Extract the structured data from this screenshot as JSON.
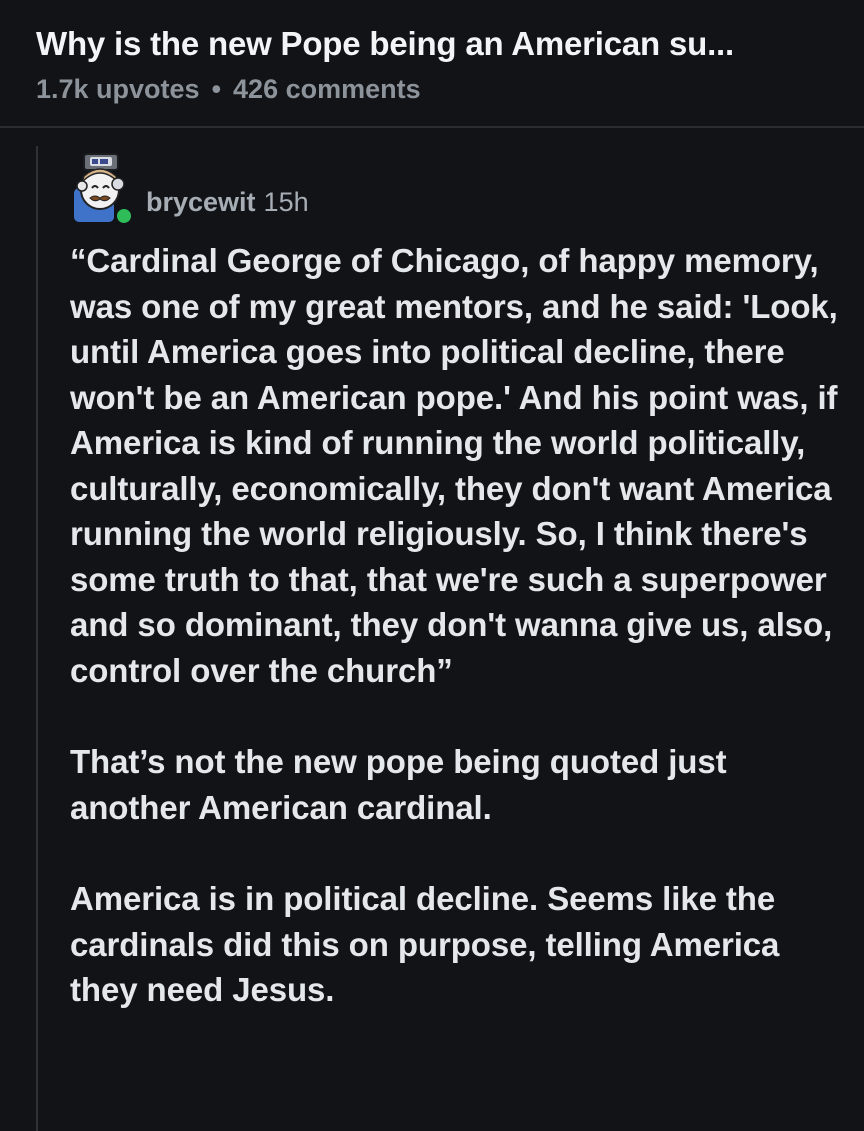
{
  "post": {
    "title": "Why is the new Pope being an American su...",
    "upvotes": "1.7k upvotes",
    "separator": "•",
    "comments": "426 comments"
  },
  "comment": {
    "username": "brycewit",
    "time": "15h",
    "avatar_icon": "snoo-avatar-icon",
    "online_color": "#2ebd59",
    "paragraphs": [
      "“Cardinal George of Chicago, of happy memory, was one of my great mentors, and he said: 'Look, until America goes into political decline, there won't be an American pope.' And his point was, if America is kind of running the world politically, culturally, economically, they don't want America running the world religiously. So, I think there's some truth to that, that we're such a superpower and so dominant, they don't wanna give us, also, control over the church”",
      "That’s not the new pope being quoted just another American cardinal.",
      "America is in political decline. Seems like the cardinals did this on purpose, telling America they need Jesus."
    ]
  }
}
